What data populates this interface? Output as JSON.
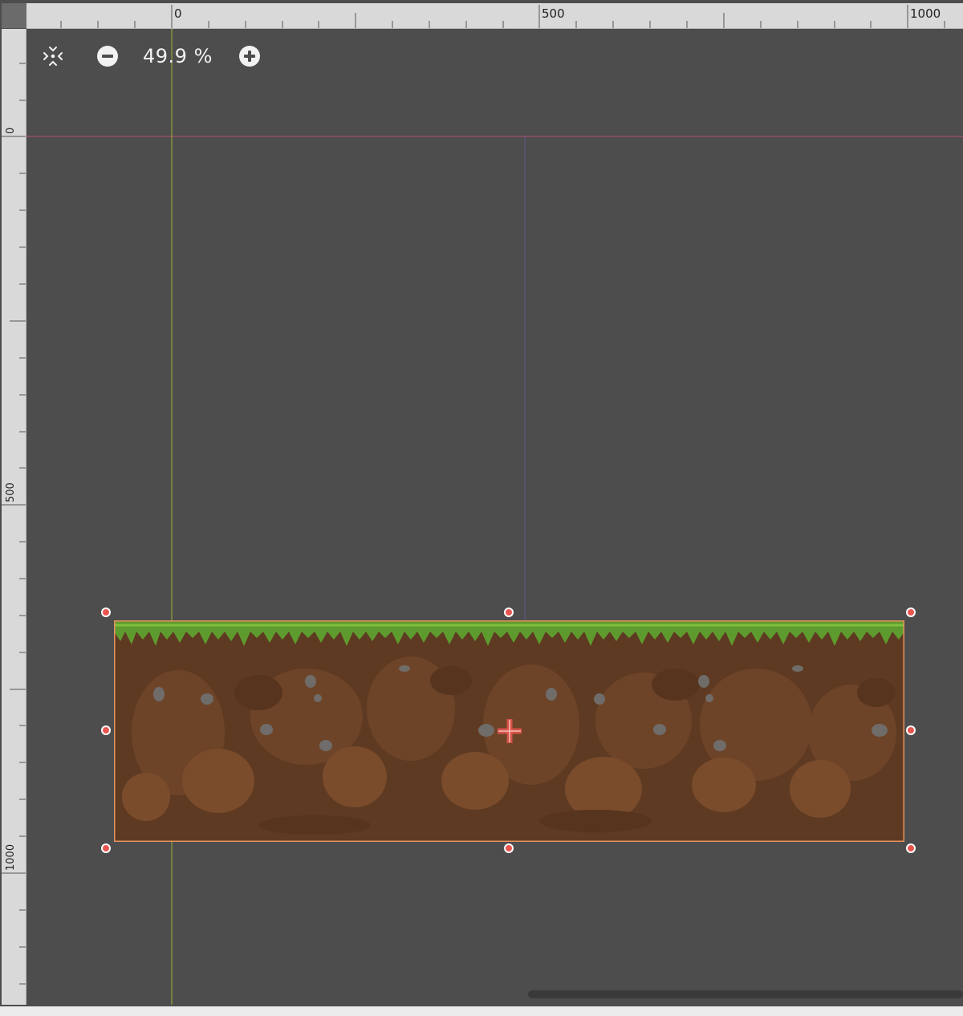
{
  "rulers": {
    "horizontal_labels": [
      "0",
      "500",
      "1000"
    ],
    "vertical_labels": [
      "0",
      "500",
      "1000"
    ]
  },
  "toolbar": {
    "center_icon": "center-view-icon",
    "zoom_out_icon": "minus-circle-icon",
    "zoom_in_icon": "plus-circle-icon",
    "zoom_label": "49.9 %"
  },
  "colors": {
    "canvas_bg": "#4d4d4d",
    "ruler_bg": "#d9d9d9",
    "selection": "#e8925e",
    "handle": "#e8554f",
    "x_axis": "#b84d6a",
    "y_axis": "#9fb23a",
    "bounds": "#5e5a8c",
    "dirt": "#5e3a22",
    "grass": "#5e9b2e"
  }
}
